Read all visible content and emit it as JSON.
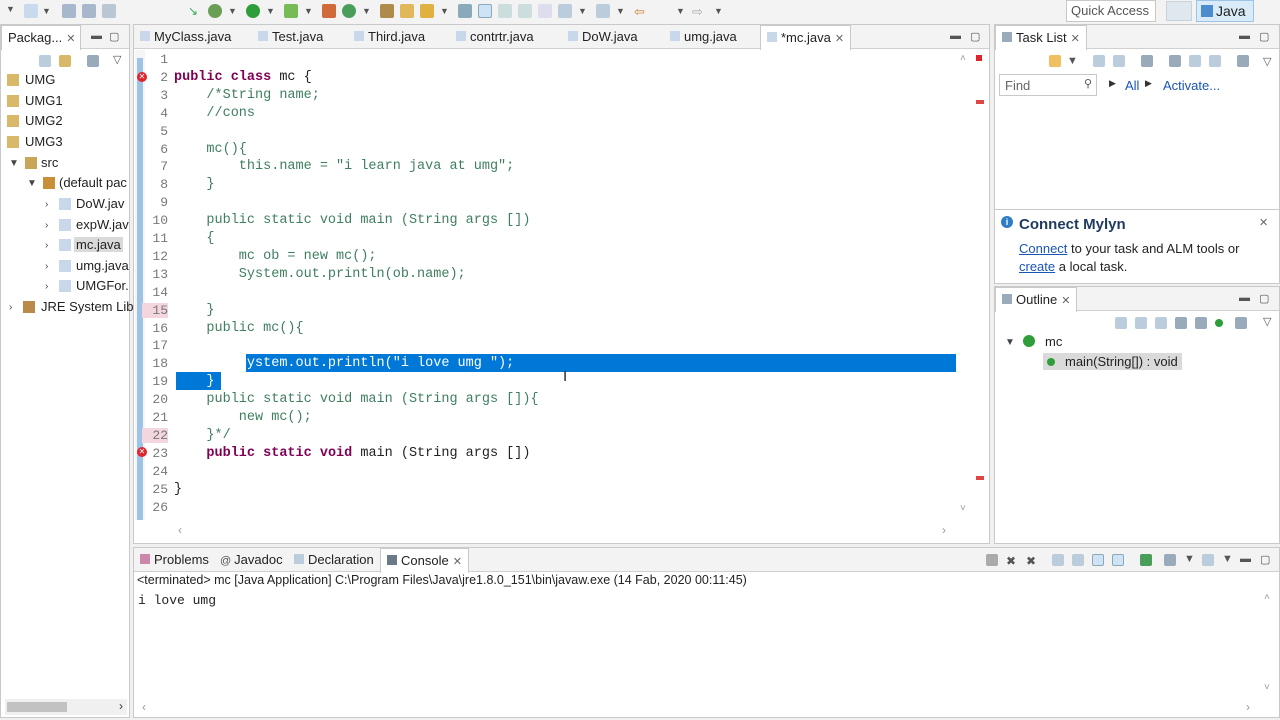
{
  "toolbar": {
    "quick_access": "Quick Access",
    "perspective": "Java"
  },
  "package_explorer": {
    "tab": "Packag...",
    "items": [
      {
        "label": "UMG"
      },
      {
        "label": "UMG1"
      },
      {
        "label": "UMG2"
      },
      {
        "label": "UMG3"
      },
      {
        "label": "src"
      },
      {
        "label": "(default pac"
      },
      {
        "label": "DoW.jav"
      },
      {
        "label": "expW.jav"
      },
      {
        "label": "mc.java"
      },
      {
        "label": "umg.java"
      },
      {
        "label": "UMGFor."
      },
      {
        "label": "JRE System Lib"
      }
    ]
  },
  "editor": {
    "tabs": [
      "MyClass.java",
      "Test.java",
      "Third.java",
      "contrtr.java",
      "DoW.java",
      "umg.java",
      "*mc.java"
    ],
    "lines": [
      {
        "n": "1",
        "text": ""
      },
      {
        "n": "2",
        "text": "public class mc {"
      },
      {
        "n": "3",
        "text": "    /*String name;"
      },
      {
        "n": "4",
        "text": "    //cons"
      },
      {
        "n": "5",
        "text": ""
      },
      {
        "n": "6",
        "text": "    mc(){"
      },
      {
        "n": "7",
        "text": "        this.name = \"i learn java at umg\";"
      },
      {
        "n": "8",
        "text": "    }"
      },
      {
        "n": "9",
        "text": ""
      },
      {
        "n": "10",
        "text": "    public static void main (String args [])"
      },
      {
        "n": "11",
        "text": "    {"
      },
      {
        "n": "12",
        "text": "        mc ob = new mc();"
      },
      {
        "n": "13",
        "text": "        System.out.println(ob.name);"
      },
      {
        "n": "14",
        "text": ""
      },
      {
        "n": "15",
        "text": "    }"
      },
      {
        "n": "16",
        "text": "    public mc(){"
      },
      {
        "n": "17",
        "text": ""
      },
      {
        "n": "18",
        "text": "        System.out.println(\"i love umg \");"
      },
      {
        "n": "19",
        "text": "    }"
      },
      {
        "n": "20",
        "text": "    public static void main (String args []){"
      },
      {
        "n": "21",
        "text": "        new mc();"
      },
      {
        "n": "22",
        "text": "    }*/"
      },
      {
        "n": "23",
        "text": "    public static void main (String args [])"
      },
      {
        "n": "24",
        "text": ""
      },
      {
        "n": "25",
        "text": "}"
      },
      {
        "n": "26",
        "text": ""
      }
    ]
  },
  "task_list": {
    "tab": "Task List",
    "find_placeholder": "Find",
    "all": "All",
    "activate": "Activate..."
  },
  "mylyn": {
    "title": "Connect Mylyn",
    "connect_link": "Connect",
    "text1": " to your task and ALM tools or",
    "create_link": "create",
    "text2": " a local task."
  },
  "outline": {
    "tab": "Outline",
    "class": "mc",
    "method": "main(String[]) : void"
  },
  "bottom": {
    "tabs": [
      "Problems",
      "Javadoc",
      "Declaration",
      "Console"
    ],
    "status": "<terminated> mc [Java Application] C:\\Program Files\\Java\\jre1.8.0_151\\bin\\javaw.exe (14 Fab, 2020 00:11:45)",
    "output": "i love umg"
  }
}
